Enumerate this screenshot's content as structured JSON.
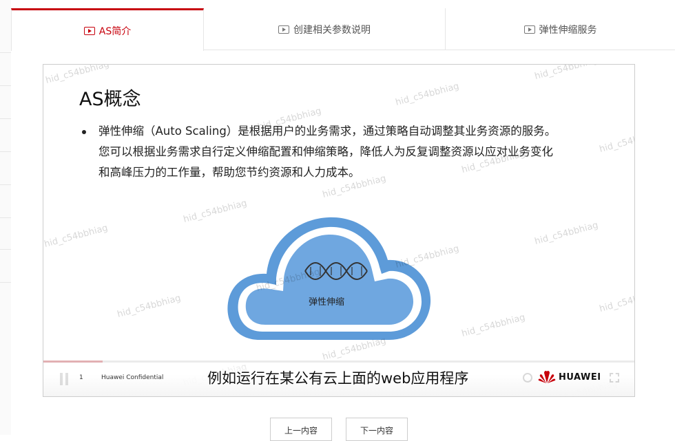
{
  "tabs": [
    {
      "label": "AS简介",
      "active": true,
      "icon": "video-icon"
    },
    {
      "label": "创建相关参数说明",
      "active": false,
      "icon": "video-icon"
    },
    {
      "label": "弹性伸缩服务",
      "active": false,
      "icon": "video-icon"
    }
  ],
  "slide": {
    "title": "AS概念",
    "bullet_lines": [
      "弹性伸缩（Auto Scaling）是根据用户的业务需求，通过策略自动调整其业务资源的服务。",
      "您可以根据业务需求自行定义伸缩配置和伸缩策略，降低人为反复调整资源以应对业务变化",
      "和高峰压力的工作量，帮助您节约资源和人力成本。"
    ],
    "cloud_label": "弹性伸缩",
    "page_number": "1",
    "confidential": "Huawei Confidential",
    "brand": "HUAWEI",
    "watermark": "hid_c54bbhiag"
  },
  "player": {
    "subtitle": "例如运行在某公有云上面的web应用程序",
    "progress": 0.1
  },
  "nav": {
    "prev_label": "上一内容",
    "next_label": "下一内容"
  },
  "colors": {
    "accent": "#c7000b",
    "cloud_fill": "#6fa7e0",
    "cloud_outline": "#5d9bd9"
  }
}
